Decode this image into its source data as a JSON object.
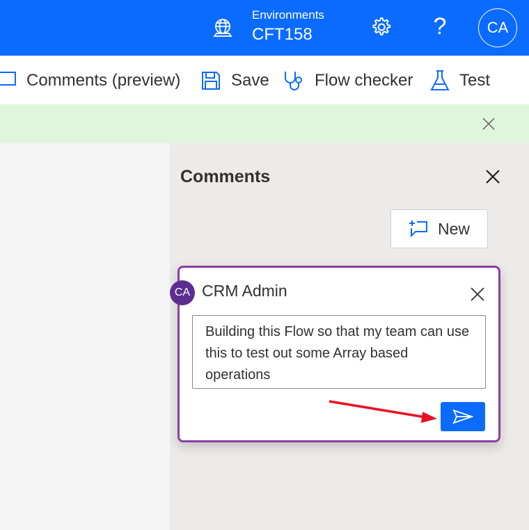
{
  "header": {
    "environment_label": "Environments",
    "environment_name": "CFT158",
    "help_glyph": "?",
    "user_initials": "CA",
    "icons": [
      "globe-icon",
      "gear-icon",
      "help-icon"
    ],
    "colors": {
      "bar": "#0b6bff"
    }
  },
  "commands": {
    "comments_label": "Comments (preview)",
    "save_label": "Save",
    "flow_checker_label": "Flow checker",
    "test_label": "Test"
  },
  "comments_panel": {
    "title": "Comments",
    "new_button_label": "New",
    "comment": {
      "author_initials": "CA",
      "author_name": "CRM Admin",
      "text": "Building this Flow so that my team can use this to test out some Array based operations"
    },
    "colors": {
      "card_border": "#8b3ea6",
      "avatar": "#5c2e91",
      "send": "#0b6bff",
      "annotation_arrow": "#e81123"
    }
  }
}
